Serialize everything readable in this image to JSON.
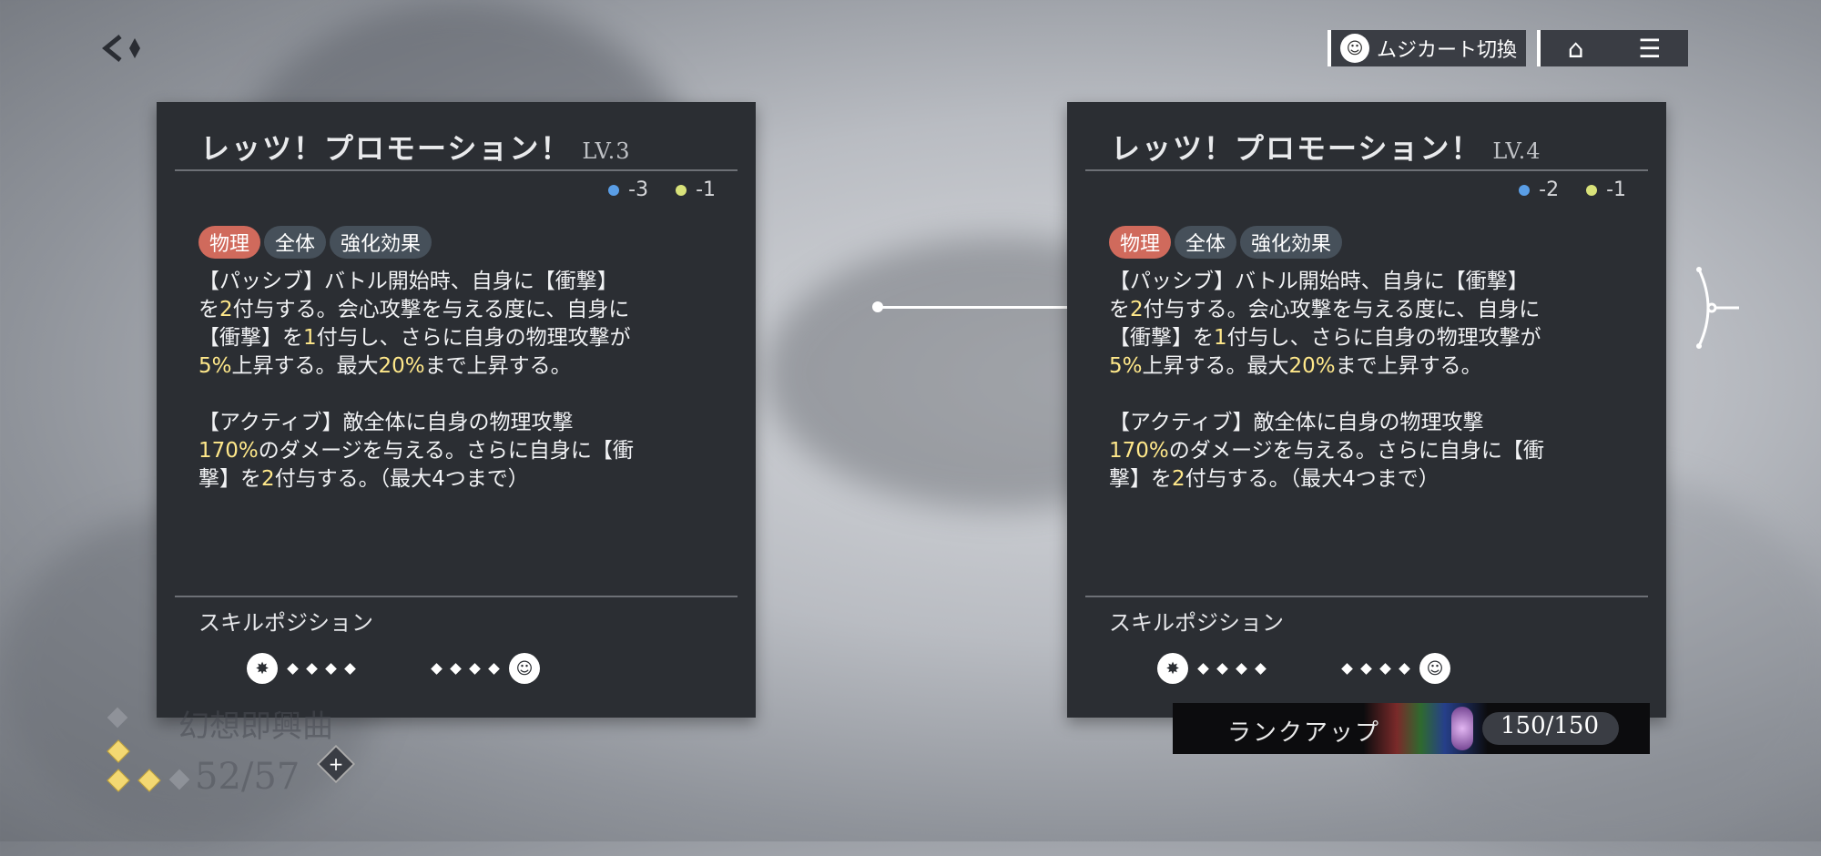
{
  "header": {
    "switch_label": "ムジカート切換",
    "icons": [
      "back-icon",
      "home-icon",
      "menu-icon"
    ]
  },
  "left_card": {
    "name": "レッツ！プロモーション！",
    "level": "LV.3",
    "cost_blue": "-3",
    "cost_yellow": "-1",
    "tags": [
      "物理",
      "全体",
      "強化効果"
    ],
    "desc1_a": "【パッシブ】バトル開始時、自身に【衝撃】",
    "desc1_b": "を",
    "desc1_b_num": "2",
    "desc1_b_rest": "付与する。会心攻撃を与える度に、自身に",
    "desc1_c": "【衝撃】を",
    "desc1_c_num": "1",
    "desc1_c_rest": "付与し、さらに自身の物理攻撃が",
    "desc1_d_num": "5%",
    "desc1_d_mid": "上昇する。最大",
    "desc1_d_num2": "20%",
    "desc1_d_rest": "まで上昇する。",
    "desc2_a": "【アクティブ】敵全体に自身の物理攻撃",
    "desc2_b_num": "170%",
    "desc2_b_rest": "のダメージを与える。さらに自身に【衝",
    "desc2_c": "撃】を",
    "desc2_c_num": "2",
    "desc2_c_rest": "付与する。（最大4つまで）",
    "position_title": "スキルポジション"
  },
  "right_card": {
    "name": "レッツ！プロモーション！",
    "level": "LV.4",
    "cost_blue": "-2",
    "cost_yellow": "-1",
    "tags": [
      "物理",
      "全体",
      "強化効果"
    ],
    "desc1_a": "【パッシブ】バトル開始時、自身に【衝撃】",
    "desc1_b": "を",
    "desc1_b_num": "2",
    "desc1_b_rest": "付与する。会心攻撃を与える度に、自身に",
    "desc1_c": "【衝撃】を",
    "desc1_c_num": "1",
    "desc1_c_rest": "付与し、さらに自身の物理攻撃が",
    "desc1_d_num": "5%",
    "desc1_d_mid": "上昇する。最大",
    "desc1_d_num2": "20%",
    "desc1_d_rest": "まで上昇する。",
    "desc2_a": "【アクティブ】敵全体に自身の物理攻撃",
    "desc2_b_num": "170%",
    "desc2_b_rest": "のダメージを与える。さらに自身に【衝",
    "desc2_c": "撃】を",
    "desc2_c_num": "2",
    "desc2_c_rest": "付与する。（最大4つまで）",
    "position_title": "スキルポジション"
  },
  "bottom_left": {
    "title": "幻想即興曲",
    "count": "52/57"
  },
  "rankup": {
    "label": "ランクアップ",
    "count": "150/150"
  },
  "colors": {
    "highlight": "#ffe88a",
    "tag_red": "#d06a5c",
    "tag_gray": "#46505a",
    "cost_blue": "#5a9ee6",
    "cost_yellow": "#d9e27a"
  }
}
